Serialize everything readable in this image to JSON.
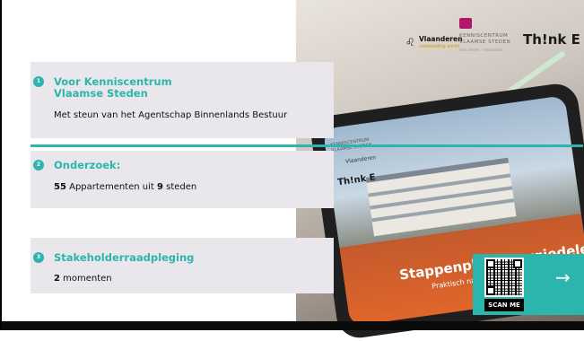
{
  "items": [
    {
      "number": "1",
      "title_line1": "Voor Kenniscentrum",
      "title_line2": "Vlaamse Steden",
      "text": "Met steun van het Agentschap Binnenlands Bestuur"
    },
    {
      "number": "2",
      "title_line1": "Onderzoek:",
      "count_a": "55",
      "text_a": " Appartementen uit ",
      "count_b": "9",
      "text_b": " steden"
    },
    {
      "number": "3",
      "title_line1": "Stakeholderraadpleging",
      "count_a": "2",
      "text_a": " momenten"
    }
  ],
  "logos": {
    "vlaanderen": "Vlaanderen",
    "vlaanderen_sub": "verbeelding werkt",
    "kc_line1": "KENNISCENTRUM",
    "kc_line2": "VLAAMSE STEDEN",
    "kc_sub": "drie steden · verbonden",
    "think": "Th!nk E"
  },
  "tablet": {
    "kc_line1": "KENNISCENTRUM",
    "kc_line2": "VLAAMSE STEDEN",
    "vlaanderen": "Vlaanderen",
    "think": "Th!nk E",
    "title": "Stappenplan Energiedelen",
    "subtitle": "Praktisch naar succesvolle projecten"
  },
  "qr": {
    "label": "SCAN ME",
    "arrow": "→"
  },
  "colors": {
    "accent": "#2cb5ad",
    "card": "#e9e7ec",
    "kc_brand": "#b0176b"
  }
}
